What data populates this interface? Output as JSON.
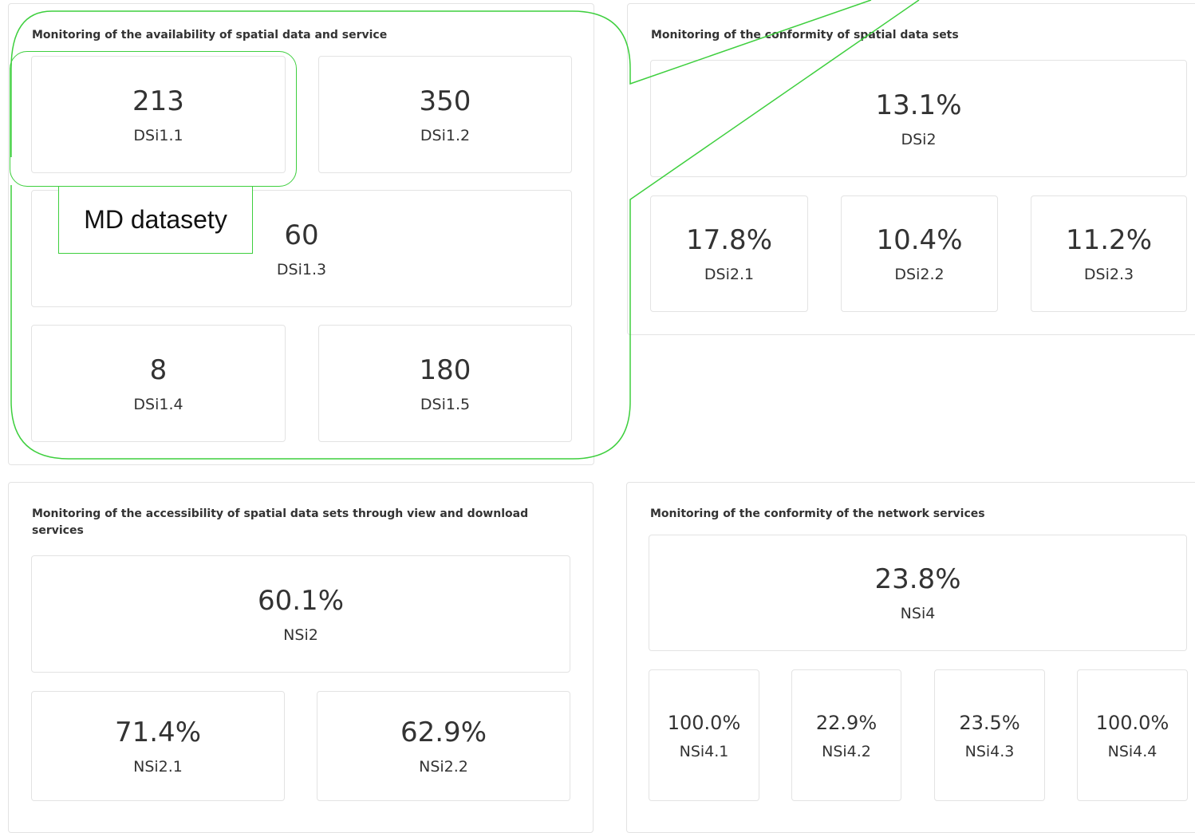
{
  "panels": {
    "availability": {
      "title": "Monitoring of the availability of spatial data and service",
      "cards": [
        {
          "value": "213",
          "code": "DSi1.1"
        },
        {
          "value": "350",
          "code": "DSi1.2"
        },
        {
          "value": "60",
          "code": "DSi1.3"
        },
        {
          "value": "8",
          "code": "DSi1.4"
        },
        {
          "value": "180",
          "code": "DSi1.5"
        }
      ]
    },
    "conformity_datasets": {
      "title": "Monitoring of the conformity of spatial data sets",
      "cards": [
        {
          "value": "13.1%",
          "code": "DSi2"
        },
        {
          "value": "17.8%",
          "code": "DSi2.1"
        },
        {
          "value": "10.4%",
          "code": "DSi2.2"
        },
        {
          "value": "11.2%",
          "code": "DSi2.3"
        }
      ]
    },
    "accessibility": {
      "title": "Monitoring of the accessibility of spatial data sets through view and download services",
      "cards": [
        {
          "value": "60.1%",
          "code": "NSi2"
        },
        {
          "value": "71.4%",
          "code": "NSi2.1"
        },
        {
          "value": "62.9%",
          "code": "NSi2.2"
        }
      ]
    },
    "network_conformity": {
      "title": "Monitoring of the conformity of the network services",
      "cards": [
        {
          "value": "23.8%",
          "code": "NSi4"
        },
        {
          "value": "100.0%",
          "code": "NSi4.1"
        },
        {
          "value": "22.9%",
          "code": "NSi4.2"
        },
        {
          "value": "23.5%",
          "code": "NSi4.3"
        },
        {
          "value": "100.0%",
          "code": "NSi4.4"
        }
      ]
    }
  },
  "annotation": {
    "label": "MD datasety",
    "color": "#3ecf3e"
  }
}
